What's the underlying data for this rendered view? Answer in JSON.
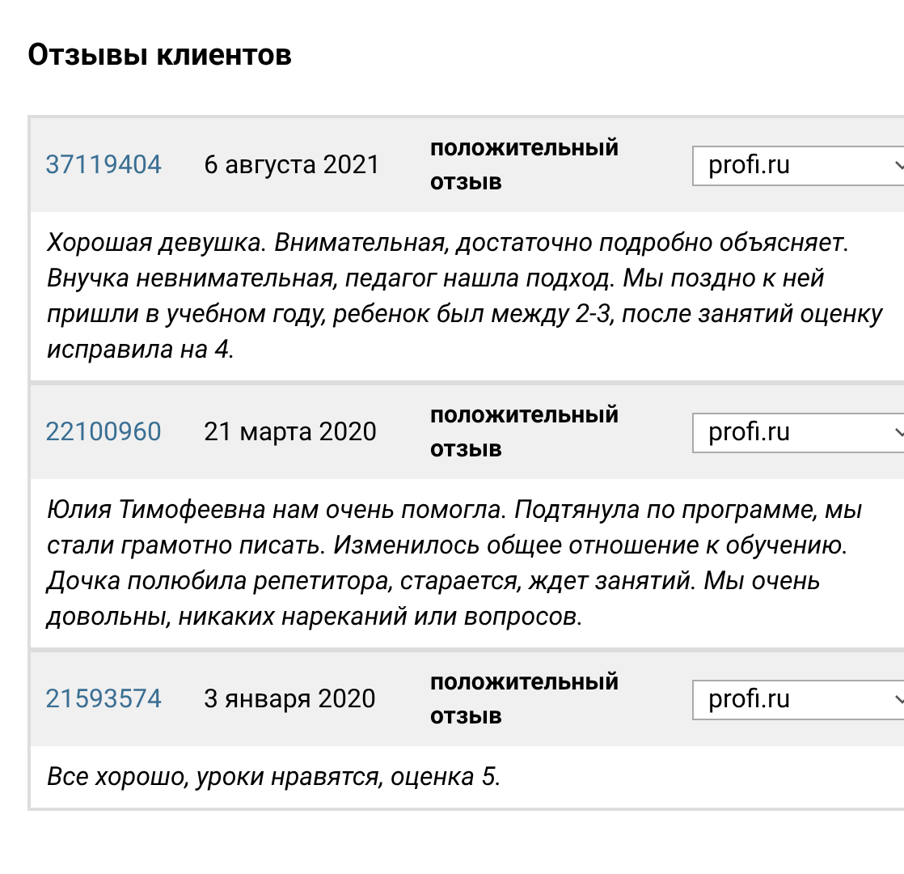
{
  "title": "Отзывы клиентов",
  "reviews": [
    {
      "id": "37119404",
      "date": "6 августа 2021",
      "type": "положительный отзыв",
      "source": "profi.ru",
      "text": "Хорошая девушка. Внимательная, достаточно подробно объясняет. Внучка невнимательная, педагог нашла подход. Мы поздно к ней пришли в учебном году, ребенок был между 2-3, после занятий оценку исправила на 4."
    },
    {
      "id": "22100960",
      "date": "21 марта 2020",
      "type": "положительный отзыв",
      "source": "profi.ru",
      "text": "Юлия Тимофеевна нам очень помогла. Подтянула по программе, мы стали грамотно писать. Изменилось общее отношение к обучению. Дочка полюбила репетитора, старается, ждет занятий. Мы очень довольны, никаких нареканий или вопросов."
    },
    {
      "id": "21593574",
      "date": "3 января 2020",
      "type": "положительный отзыв",
      "source": "profi.ru",
      "text": "Все хорошо, уроки нравятся, оценка 5."
    }
  ]
}
